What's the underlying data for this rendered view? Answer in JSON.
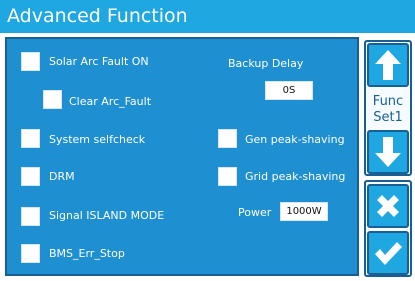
{
  "header": {
    "title": "Advanced Function"
  },
  "options": {
    "solar_arc_fault_on": "Solar Arc Fault ON",
    "clear_arc_fault": "Clear Arc_Fault",
    "system_selfcheck": "System selfcheck",
    "drm": "DRM",
    "signal_island_mode": "Signal ISLAND MODE",
    "bms_err_stop": "BMS_Err_Stop",
    "gen_peak_shaving": "Gen peak-shaving",
    "grid_peak_shaving": "Grid peak-shaving"
  },
  "backup_delay": {
    "label": "Backup Delay",
    "value": "0S"
  },
  "power": {
    "label": "Power",
    "value": "1000W"
  },
  "sidebar": {
    "func_label": "Func",
    "set_label": "Set1"
  },
  "colors": {
    "header": "#1ea7e1",
    "panel": "#1e8fd0",
    "border": "#1a5f93",
    "text": "#ffffff"
  }
}
